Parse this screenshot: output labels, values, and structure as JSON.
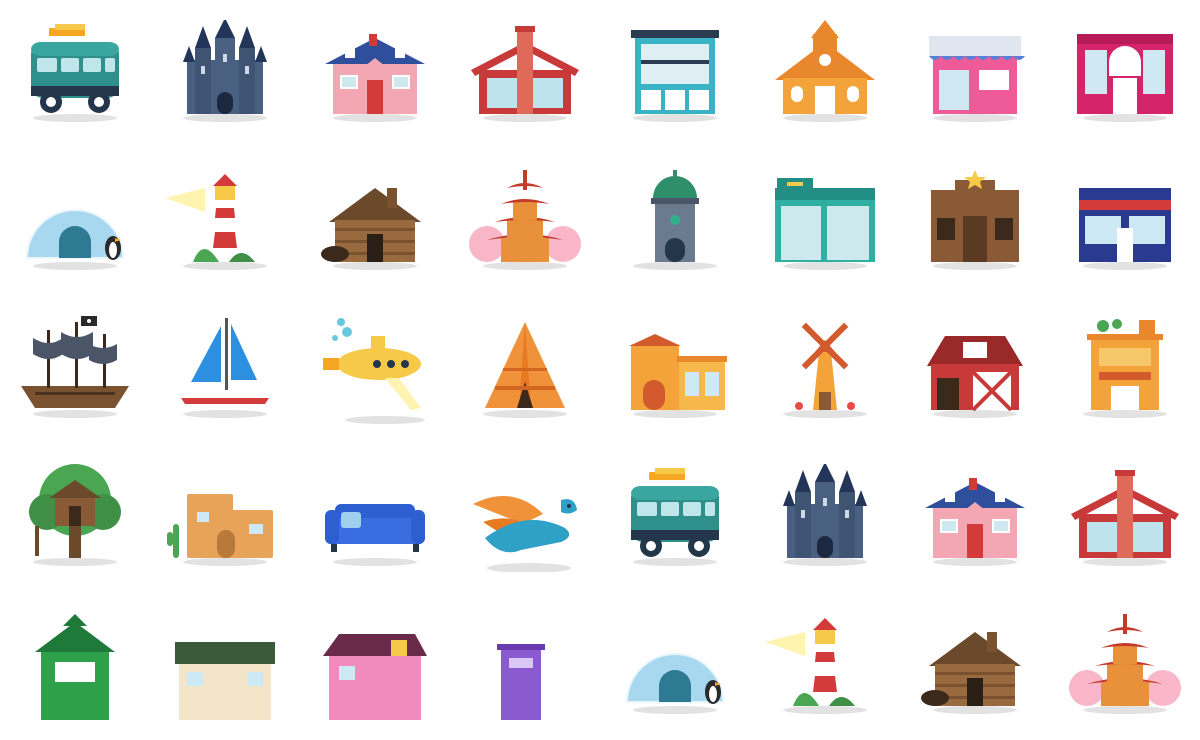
{
  "icons": [
    {
      "name": "van-icon"
    },
    {
      "name": "castle-icon"
    },
    {
      "name": "house-icon"
    },
    {
      "name": "chimney-house-icon"
    },
    {
      "name": "office-building-icon"
    },
    {
      "name": "chapel-icon"
    },
    {
      "name": "shop-icon"
    },
    {
      "name": "store-icon"
    },
    {
      "name": "igloo-icon"
    },
    {
      "name": "lighthouse-icon"
    },
    {
      "name": "log-cabin-icon"
    },
    {
      "name": "pagoda-icon"
    },
    {
      "name": "observatory-tower-icon"
    },
    {
      "name": "gym-icon"
    },
    {
      "name": "saloon-icon"
    },
    {
      "name": "storefront-icon"
    },
    {
      "name": "pirate-ship-icon"
    },
    {
      "name": "sailboat-icon"
    },
    {
      "name": "submarine-icon"
    },
    {
      "name": "teepee-icon"
    },
    {
      "name": "villa-icon"
    },
    {
      "name": "windmill-icon"
    },
    {
      "name": "barn-icon"
    },
    {
      "name": "rooftop-building-icon"
    },
    {
      "name": "treehouse-icon"
    },
    {
      "name": "adobe-house-icon"
    },
    {
      "name": "sofa-icon"
    },
    {
      "name": "dragon-icon"
    },
    {
      "name": "van-icon"
    },
    {
      "name": "castle-icon"
    },
    {
      "name": "house-icon"
    },
    {
      "name": "chimney-house-icon"
    },
    {
      "name": "green-tower-icon"
    },
    {
      "name": "green-roof-house-icon"
    },
    {
      "name": "pink-house-icon"
    },
    {
      "name": "purple-building-icon"
    },
    {
      "name": "igloo-icon"
    },
    {
      "name": "lighthouse-icon"
    },
    {
      "name": "log-cabin-icon"
    },
    {
      "name": "pagoda-icon"
    }
  ]
}
